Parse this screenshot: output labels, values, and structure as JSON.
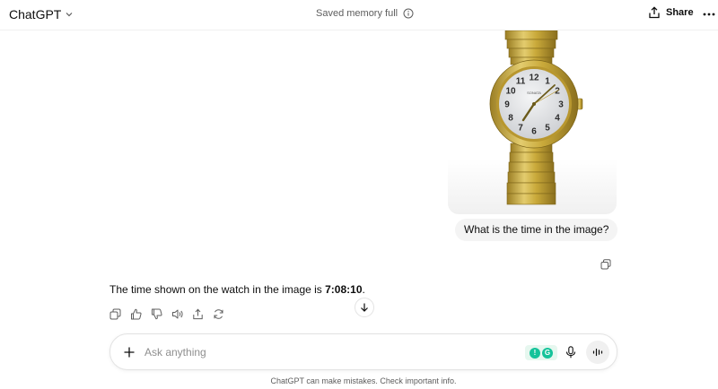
{
  "header": {
    "model_label": "ChatGPT",
    "memory_status": "Saved memory full",
    "share_label": "Share"
  },
  "conversation": {
    "user_prompt": "What is the time in the image?",
    "assistant_prefix": "The time shown on the watch in the image is ",
    "assistant_time": "7:08:10",
    "assistant_suffix": ".",
    "watch": {
      "dial_numbers": [
        "12",
        "1",
        "2",
        "3",
        "4",
        "5",
        "6",
        "7",
        "8",
        "9",
        "10",
        "11"
      ],
      "brand_mark": "SONATA",
      "case_color": "#c9a93a",
      "dial_color": "#e4e5e7"
    }
  },
  "composer": {
    "placeholder": "Ask anything",
    "extension_badges": [
      "!",
      "G"
    ]
  },
  "footer": {
    "disclaimer": "ChatGPT can make mistakes. Check important info."
  },
  "icons": [
    "chevron-down-icon",
    "info-icon",
    "share-icon",
    "more-icon",
    "copy-icon",
    "thumbs-up-icon",
    "thumbs-down-icon",
    "read-aloud-icon",
    "share-response-icon",
    "regenerate-icon",
    "arrow-down-icon",
    "plus-icon",
    "mic-icon",
    "voice-mode-icon"
  ]
}
